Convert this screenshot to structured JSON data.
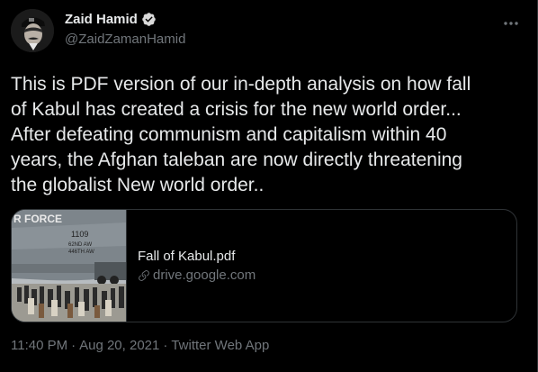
{
  "author": {
    "display_name": "Zaid Hamid",
    "handle": "@ZaidZamanHamid",
    "verified_icon": "verified-badge-icon"
  },
  "tweet": {
    "text": "This is PDF version of our in-depth analysis on how fall of Kabul has created a crisis for the new world order... After defeating communism and capitalism within 40 years, the Afghan taleban are now directly threatening the globalist New world order..",
    "text_lines": [
      "This is PDF version of our in-depth analysis on how fall",
      "of Kabul has created a crisis for the new world order...",
      "After defeating communism and capitalism within 40",
      "years, the Afghan taleban are now directly threatening",
      "the globalist New world order.."
    ]
  },
  "card": {
    "title": "Fall of Kabul.pdf",
    "domain": "drive.google.com",
    "thumbnail_text": {
      "force": "R FORCE",
      "tail_number": "1109",
      "wing_1": "62ND AW",
      "wing_2": "446TH AW"
    }
  },
  "meta": {
    "time": "11:40 PM",
    "separator": "·",
    "date": "Aug 20, 2021",
    "source": "Twitter Web App"
  },
  "colors": {
    "background": "#000000",
    "primary_text": "#e7e9ea",
    "secondary_text": "#71767b",
    "border": "#2f3336",
    "verified": "#d9d9d9"
  }
}
